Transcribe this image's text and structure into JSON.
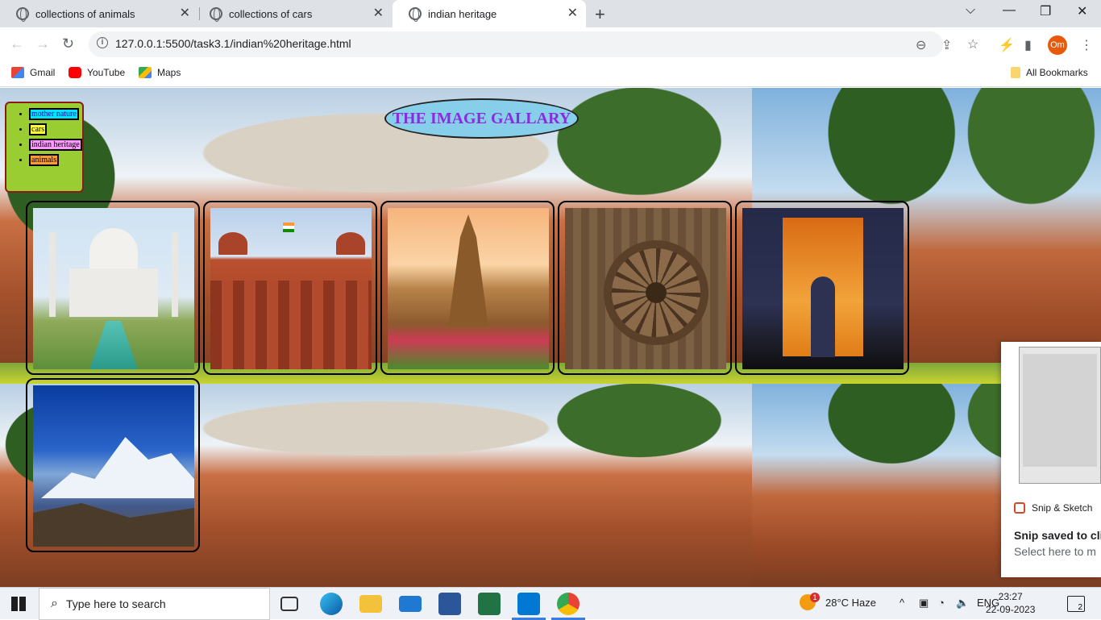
{
  "browser": {
    "tabs": [
      {
        "label": "collections of animals",
        "active": false
      },
      {
        "label": "collections of cars",
        "active": false
      },
      {
        "label": "indian heritage",
        "active": true
      }
    ],
    "url": "127.0.0.1:5500/task3.1/indian%20heritage.html",
    "profile_initials": "Om",
    "bookmarks": [
      {
        "label": "Gmail",
        "icon": "gmail-icon"
      },
      {
        "label": "YouTube",
        "icon": "youtube-icon"
      },
      {
        "label": "Maps",
        "icon": "maps-icon"
      }
    ],
    "all_bookmarks_label": "All Bookmarks"
  },
  "page": {
    "title": "THE IMAGE GALLARY",
    "menu": [
      {
        "label": "mother nature",
        "bg": "#00e5ff"
      },
      {
        "label": "cars",
        "bg": "#ffff33"
      },
      {
        "label": "indian heritage",
        "bg": "#ff99ff"
      },
      {
        "label": "animals",
        "bg": "#ff9933"
      }
    ],
    "gallery": [
      {
        "subject": "Taj Mahal"
      },
      {
        "subject": "Red Fort"
      },
      {
        "subject": "Khajuraho temple"
      },
      {
        "subject": "Konark sun temple wheel"
      },
      {
        "subject": "India Gate"
      },
      {
        "subject": "Himalayan mountains"
      }
    ],
    "menu_box_color": "#9acd32",
    "title_bg": "#87ceeb",
    "title_color": "#8a2be2"
  },
  "notification": {
    "app": "Snip & Sketch",
    "heading": "Snip saved to cli",
    "subtext": "Select here to m"
  },
  "taskbar": {
    "search_placeholder": "Type here to search",
    "weather": "28°C  Haze",
    "weather_badge": "1",
    "language": "ENG",
    "time": "23:27",
    "date": "22-09-2023",
    "notification_count": "2"
  }
}
